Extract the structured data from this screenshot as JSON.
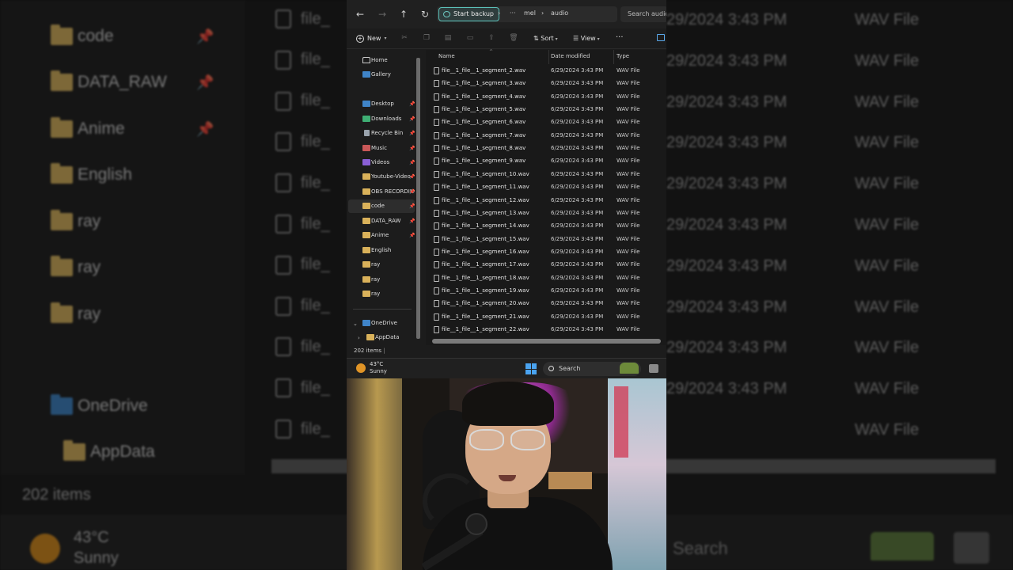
{
  "address_bar": {
    "backup_label": "Start backup",
    "more_glyph": "···",
    "crumbs": [
      "mel",
      "audio"
    ],
    "search_placeholder": "Search audio"
  },
  "toolbar": {
    "new_label": "New",
    "sort_label": "Sort",
    "view_label": "View",
    "more_glyph": "···"
  },
  "nav": {
    "items": [
      {
        "label": "Home",
        "icon": "home-icon"
      },
      {
        "label": "Gallery",
        "icon": "gallery-icon"
      },
      {
        "label": "Desktop",
        "icon": "desktop-icon",
        "pinned": true
      },
      {
        "label": "Downloads",
        "icon": "downloads-icon",
        "pinned": true
      },
      {
        "label": "Recycle Bin",
        "icon": "recycle-bin-icon",
        "pinned": true
      },
      {
        "label": "Music",
        "icon": "music-icon",
        "pinned": true
      },
      {
        "label": "Videos",
        "icon": "videos-icon",
        "pinned": true
      },
      {
        "label": "Youtube-Video",
        "icon": "folder-icon",
        "pinned": true
      },
      {
        "label": "OBS RECORDINGS",
        "icon": "folder-icon",
        "pinned": true
      },
      {
        "label": "code",
        "icon": "folder-icon",
        "pinned": true,
        "selected": true
      },
      {
        "label": "DATA_RAW",
        "icon": "folder-icon",
        "pinned": true
      },
      {
        "label": "Anime",
        "icon": "folder-icon",
        "pinned": true
      },
      {
        "label": "English",
        "icon": "folder-icon"
      },
      {
        "label": "ray",
        "icon": "folder-icon"
      },
      {
        "label": "ray",
        "icon": "folder-icon"
      },
      {
        "label": "ray",
        "icon": "folder-icon"
      },
      {
        "label": "OneDrive",
        "icon": "onedrive-icon"
      },
      {
        "label": "AppData",
        "icon": "folder-icon"
      }
    ]
  },
  "columns": {
    "name": "Name",
    "date": "Date modified",
    "type": "Type"
  },
  "files": [
    {
      "name": "file__1_file__1_segment_2.wav",
      "date": "6/29/2024 3:43 PM",
      "type": "WAV File"
    },
    {
      "name": "file__1_file__1_segment_3.wav",
      "date": "6/29/2024 3:43 PM",
      "type": "WAV File"
    },
    {
      "name": "file__1_file__1_segment_4.wav",
      "date": "6/29/2024 3:43 PM",
      "type": "WAV File"
    },
    {
      "name": "file__1_file__1_segment_5.wav",
      "date": "6/29/2024 3:43 PM",
      "type": "WAV File"
    },
    {
      "name": "file__1_file__1_segment_6.wav",
      "date": "6/29/2024 3:43 PM",
      "type": "WAV File"
    },
    {
      "name": "file__1_file__1_segment_7.wav",
      "date": "6/29/2024 3:43 PM",
      "type": "WAV File"
    },
    {
      "name": "file__1_file__1_segment_8.wav",
      "date": "6/29/2024 3:43 PM",
      "type": "WAV File"
    },
    {
      "name": "file__1_file__1_segment_9.wav",
      "date": "6/29/2024 3:43 PM",
      "type": "WAV File"
    },
    {
      "name": "file__1_file__1_segment_10.wav",
      "date": "6/29/2024 3:43 PM",
      "type": "WAV File"
    },
    {
      "name": "file__1_file__1_segment_11.wav",
      "date": "6/29/2024 3:43 PM",
      "type": "WAV File"
    },
    {
      "name": "file__1_file__1_segment_12.wav",
      "date": "6/29/2024 3:43 PM",
      "type": "WAV File"
    },
    {
      "name": "file__1_file__1_segment_13.wav",
      "date": "6/29/2024 3:43 PM",
      "type": "WAV File"
    },
    {
      "name": "file__1_file__1_segment_14.wav",
      "date": "6/29/2024 3:43 PM",
      "type": "WAV File"
    },
    {
      "name": "file__1_file__1_segment_15.wav",
      "date": "6/29/2024 3:43 PM",
      "type": "WAV File"
    },
    {
      "name": "file__1_file__1_segment_16.wav",
      "date": "6/29/2024 3:43 PM",
      "type": "WAV File"
    },
    {
      "name": "file__1_file__1_segment_17.wav",
      "date": "6/29/2024 3:43 PM",
      "type": "WAV File"
    },
    {
      "name": "file__1_file__1_segment_18.wav",
      "date": "6/29/2024 3:43 PM",
      "type": "WAV File"
    },
    {
      "name": "file__1_file__1_segment_19.wav",
      "date": "6/29/2024 3:43 PM",
      "type": "WAV File"
    },
    {
      "name": "file__1_file__1_segment_20.wav",
      "date": "6/29/2024 3:43 PM",
      "type": "WAV File"
    },
    {
      "name": "file__1_file__1_segment_21.wav",
      "date": "6/29/2024 3:43 PM",
      "type": "WAV File"
    },
    {
      "name": "file__1_file__1_segment_22.wav",
      "date": "6/29/2024 3:43 PM",
      "type": "WAV File"
    }
  ],
  "status": {
    "item_count": "202 items"
  },
  "taskbar": {
    "temperature": "43°C",
    "condition": "Sunny",
    "search_label": "Search"
  },
  "background": {
    "nav_labels": [
      "code",
      "DATA_RAW",
      "Anime",
      "English",
      "ray",
      "ray",
      "ray",
      "OneDrive",
      "AppData"
    ],
    "file_fragment": "file_",
    "date_fragment": "29/2024 3:43 PM",
    "type_label": "WAV File"
  },
  "colors": {
    "accent": "#4aa3f0",
    "folder": "#d9b15a",
    "backup_border": "#5bc0b8"
  }
}
